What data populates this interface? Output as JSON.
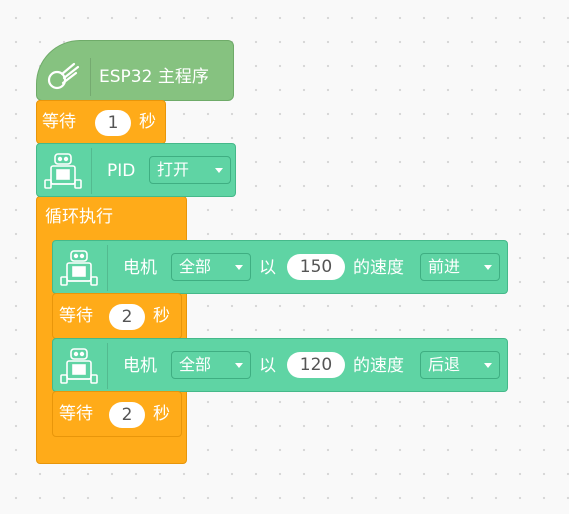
{
  "program": {
    "hat_label": "ESP32 主程序",
    "wait1": {
      "prefix": "等待",
      "value": "1",
      "unit": "秒"
    },
    "pid": {
      "label": "PID",
      "option": "打开"
    },
    "loop_label": "循环执行",
    "motor1": {
      "label": "电机",
      "target": "全部",
      "with": "以",
      "speed": "150",
      "speed_label": "的速度",
      "direction": "前进"
    },
    "wait2": {
      "prefix": "等待",
      "value": "2",
      "unit": "秒"
    },
    "motor2": {
      "label": "电机",
      "target": "全部",
      "with": "以",
      "speed": "120",
      "speed_label": "的速度",
      "direction": "后退"
    },
    "wait3": {
      "prefix": "等待",
      "value": "2",
      "unit": "秒"
    }
  },
  "colors": {
    "hat": "#86c280",
    "control": "#ffab19",
    "motor": "#5fd4a4",
    "canvas": "#f9f9f9"
  },
  "icons": [
    "rocket-icon",
    "robot-icon",
    "dropdown-arrow-icon"
  ]
}
